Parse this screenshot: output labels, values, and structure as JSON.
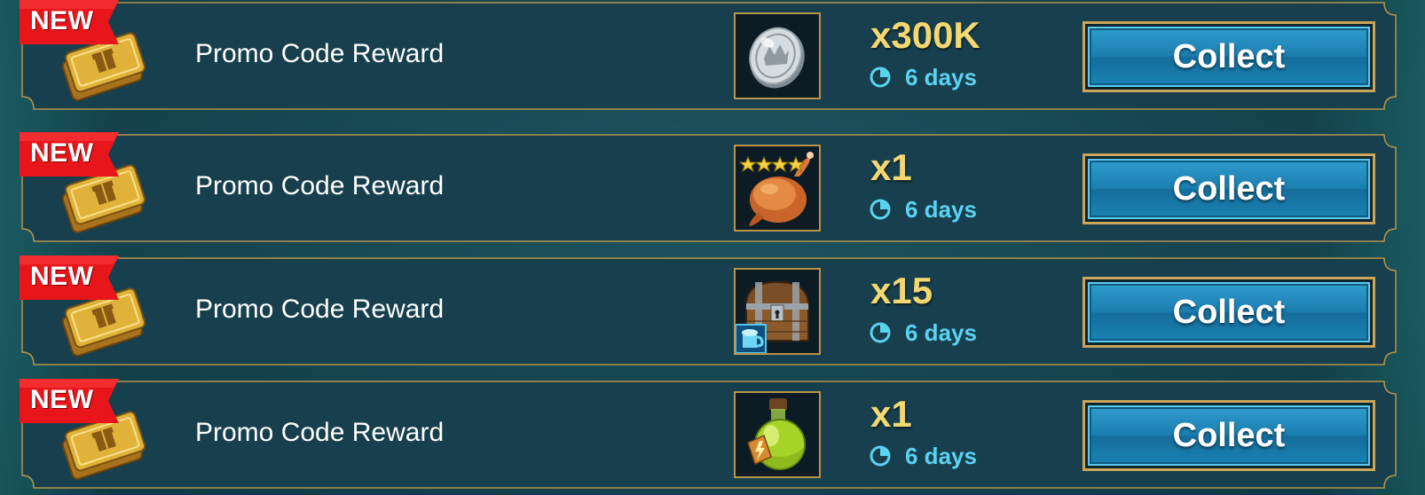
{
  "rewards": [
    {
      "badge": "NEW",
      "title": "Promo Code Reward",
      "item_icon": "roast-chicken-4-star-icon",
      "quantity": "x1",
      "time_left": "6 days",
      "button_label": "Collect"
    },
    {
      "badge": "NEW",
      "title": "Promo Code Reward",
      "item_icon": "treasure-chest-icon",
      "quantity": "x15",
      "time_left": "6 days",
      "button_label": "Collect"
    },
    {
      "badge": "NEW",
      "title": "Promo Code Reward",
      "item_icon": "energy-potion-icon",
      "quantity": "x1",
      "time_left": "6 days",
      "button_label": "Collect"
    },
    {
      "badge": "NEW",
      "title": "Promo Code Reward",
      "item_icon": "silver-coin-icon",
      "quantity": "x300K",
      "time_left": "6 days",
      "button_label": "Collect"
    }
  ],
  "colors": {
    "background": "#164752",
    "frame_gold": "#b8944a",
    "quantity_gold": "#f3d872",
    "timer_blue": "#5ad2f2",
    "button_blue": "#1b7fb0",
    "badge_red": "#e8151b"
  }
}
